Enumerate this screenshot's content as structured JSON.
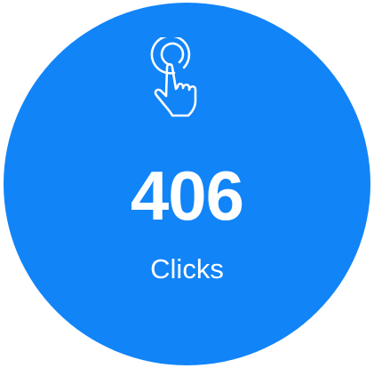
{
  "stat": {
    "icon": "tap-hand-icon",
    "value": "406",
    "label": "Clicks",
    "background_color": "#1184f8",
    "text_color": "#ffffff"
  }
}
